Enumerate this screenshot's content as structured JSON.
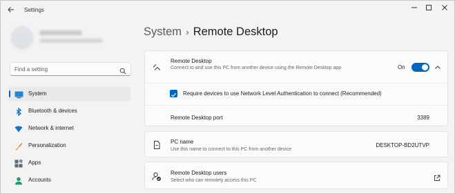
{
  "window": {
    "title": "Settings"
  },
  "search": {
    "placeholder": "Find a setting"
  },
  "nav": {
    "items": [
      {
        "label": "System",
        "icon": "system-icon"
      },
      {
        "label": "Bluetooth & devices",
        "icon": "bluetooth-icon"
      },
      {
        "label": "Network & internet",
        "icon": "network-icon"
      },
      {
        "label": "Personalization",
        "icon": "brush-icon"
      },
      {
        "label": "Apps",
        "icon": "apps-icon"
      },
      {
        "label": "Accounts",
        "icon": "person-icon"
      }
    ]
  },
  "breadcrumb": {
    "parent": "System",
    "separator": "›",
    "current": "Remote Desktop"
  },
  "remote_desktop": {
    "title": "Remote Desktop",
    "description": "Connect to and use this PC from another device using the Remote Desktop app",
    "state_label": "On",
    "enabled": true,
    "nla_label": "Require devices to use Network Level Authentication to connect (Recommended)",
    "nla_checked": true,
    "port_label": "Remote Desktop port",
    "port_value": "3389"
  },
  "pc_name": {
    "title": "PC name",
    "description": "Use this name to connect to this PC from another device",
    "value": "DESKTOP-BD2UTVP"
  },
  "users": {
    "title": "Remote Desktop users",
    "description": "Select who can remotely access this PC"
  },
  "colors": {
    "accent": "#0067c0",
    "background": "#f3f3f3",
    "card": "#fbfbfb"
  }
}
